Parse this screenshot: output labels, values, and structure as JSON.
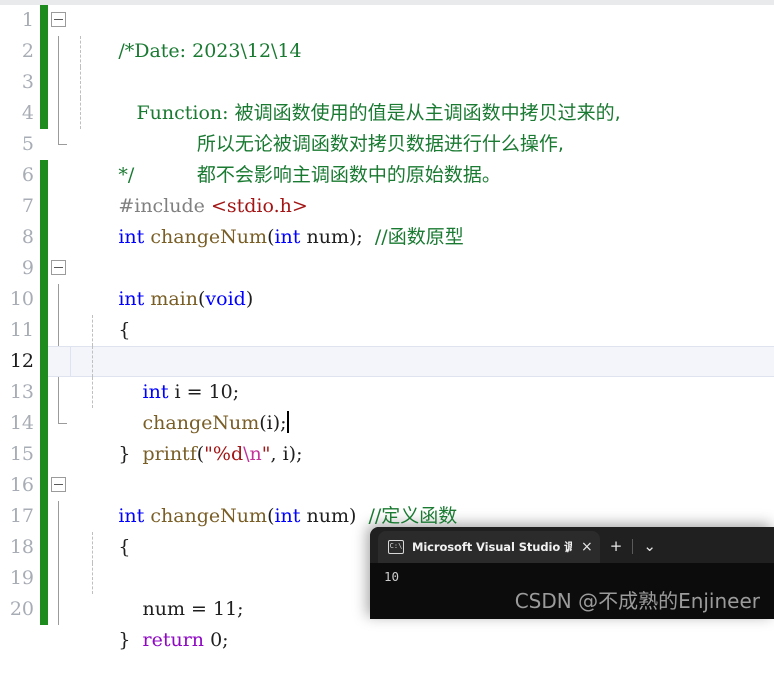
{
  "editor": {
    "app": "Visual Studio C/C++ editor",
    "gutter_line_numbers": [
      "1",
      "2",
      "3",
      "4",
      "5",
      "6",
      "7",
      "8",
      "9",
      "10",
      "11",
      "12",
      "13",
      "14",
      "15",
      "16",
      "17",
      "18",
      "19",
      "20"
    ],
    "current_line": "12",
    "lines": [
      {
        "n": "1",
        "changed": true,
        "text": "/*Date: 2023\\12\\14"
      },
      {
        "n": "2",
        "changed": true,
        "text": "   Function: 被调函数使用的值是从主调函数中拷贝过来的,"
      },
      {
        "n": "3",
        "changed": true,
        "text": "             所以无论被调函数对拷贝数据进行什么操作,"
      },
      {
        "n": "4",
        "changed": true,
        "text": "             都不会影响主调函数中的原始数据。"
      },
      {
        "n": "5",
        "changed": false,
        "text": "*/"
      },
      {
        "n": "6",
        "changed": true,
        "text": "#include <stdio.h>"
      },
      {
        "n": "7",
        "changed": true,
        "text": "int changeNum(int num);  //函数原型"
      },
      {
        "n": "8",
        "changed": true,
        "text": ""
      },
      {
        "n": "9",
        "changed": true,
        "text": "int main(void)"
      },
      {
        "n": "10",
        "changed": true,
        "text": "{"
      },
      {
        "n": "11",
        "changed": true,
        "text": "    int i = 10;"
      },
      {
        "n": "12",
        "changed": true,
        "text": "    changeNum(i);"
      },
      {
        "n": "13",
        "changed": true,
        "text": "    printf(\"%d\\n\", i);"
      },
      {
        "n": "14",
        "changed": true,
        "text": "}"
      },
      {
        "n": "15",
        "changed": true,
        "text": ""
      },
      {
        "n": "16",
        "changed": true,
        "text": "int changeNum(int num)  //定义函数"
      },
      {
        "n": "17",
        "changed": true,
        "text": "{"
      },
      {
        "n": "18",
        "changed": true,
        "text": "    num = 11;"
      },
      {
        "n": "19",
        "changed": true,
        "text": "    return 0;"
      },
      {
        "n": "20",
        "changed": true,
        "text": "}"
      }
    ],
    "tokens": {
      "line1": {
        "comment": "/*Date: 2023\\12\\14"
      },
      "line2": {
        "comment_label": "   Function: ",
        "comment_cjk": "被调函数使用的值是从主调函数中拷贝过来的,"
      },
      "line3": {
        "comment_cjk": "所以无论被调函数对拷贝数据进行什么操作,"
      },
      "line4": {
        "comment_cjk": "都不会影响主调函数中的原始数据。"
      },
      "line5": {
        "comment": "*/"
      },
      "line6": {
        "directive": "#include ",
        "header": "<stdio.h>"
      },
      "line7": {
        "kw": "int",
        "fn": "changeNum",
        "kw2": "int",
        "param": "num",
        "tail": ");",
        "comment": "//函数原型"
      },
      "line9": {
        "kw": "int",
        "fn": "main",
        "kw2": "void"
      },
      "line10": {
        "brace": "{"
      },
      "line11": {
        "kw": "int",
        "rest": " i = 10;"
      },
      "line12": {
        "fn": "changeNum",
        "rest": "(i);"
      },
      "line13": {
        "fn": "printf",
        "open": "(",
        "str_open": "\"%d",
        "esc": "\\n",
        "str_close": "\"",
        "rest": ", i);"
      },
      "line14": {
        "brace": "}"
      },
      "line16": {
        "kw": "int",
        "fn": "changeNum",
        "kw2": "int",
        "param": "num",
        "tail": ")",
        "comment": "//定义函数"
      },
      "line17": {
        "brace": "{"
      },
      "line18": {
        "text": "num = 11;"
      },
      "line19": {
        "ctl": "return",
        "rest": " 0;"
      },
      "line20": {
        "brace": "}"
      }
    },
    "colors": {
      "keyword": "#0000ff",
      "control": "#8f08c4",
      "string": "#a31515",
      "escape": "#c4329b",
      "comment": "#1a7a32",
      "function": "#795e26",
      "preprocessor": "#808080",
      "change_bar": "#1e8b1e",
      "line_number": "#a7acb5",
      "current_line_bg": "#f4f5fa",
      "background": "#ffffff"
    },
    "fold_markers": [
      "1",
      "9",
      "16"
    ]
  },
  "console": {
    "icon": "cmd-prompt-icon",
    "tab_title": "Microsoft Visual Studio 调试控",
    "close_label": "×",
    "new_tab_label": "+",
    "dropdown_label": "⌄",
    "output": "10",
    "watermark": "CSDN @不成熟的Enjineer"
  }
}
